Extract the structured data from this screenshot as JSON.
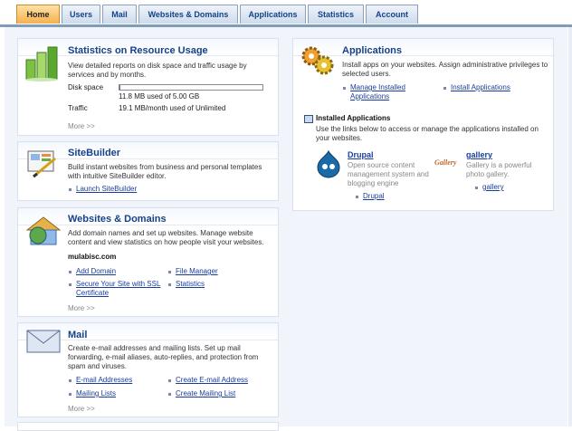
{
  "tabs": [
    "Home",
    "Users",
    "Mail",
    "Websites & Domains",
    "Applications",
    "Statistics",
    "Account"
  ],
  "stats": {
    "title": "Statistics on Resource Usage",
    "desc": "View detailed reports on disk space and traffic usage by services and by months.",
    "disk_label": "Disk space",
    "disk_value": "11.8 MB used of 5.00 GB",
    "disk_used_fraction": 0.0024,
    "traffic_label": "Traffic",
    "traffic_value": "19.1 MB/month used of Unlimited",
    "more": "More >>"
  },
  "sitebuilder": {
    "title": "SiteBuilder",
    "desc": "Build instant websites from business and personal templates with intuitive SiteBuilder editor.",
    "link": "Launch SiteBuilder"
  },
  "websites": {
    "title": "Websites & Domains",
    "desc": "Add domain names and set up websites. Manage website content and view statistics on how people visit your websites.",
    "domain": "mulabisc.com",
    "links": [
      "Add Domain",
      "File Manager",
      "Secure Your Site with SSL Certificate",
      "Statistics"
    ],
    "more": "More >>"
  },
  "mail": {
    "title": "Mail",
    "desc": "Create e-mail addresses and mailing lists. Set up mail forwarding, e-mail aliases, auto-replies, and protection from spam and viruses.",
    "links": [
      "E-mail Addresses",
      "Create E-mail Address",
      "Mailing Lists",
      "Create Mailing List"
    ],
    "more": "More >>"
  },
  "applications": {
    "title": "Applications",
    "desc": "Install apps on your websites. Assign administrative privileges to selected users.",
    "links": [
      "Manage Installed Applications",
      "Install Applications"
    ],
    "installed_title": "Installed Applications",
    "installed_desc": "Use the links below to access or manage the applications installed on your websites.",
    "apps": [
      {
        "name": "Drupal",
        "desc": "Open source content management system and blogging engine",
        "link": "Drupal"
      },
      {
        "name": "gallery",
        "icon_text": "Gallery",
        "desc": "Gallery is a powerful photo gallery.",
        "link": "gallery"
      }
    ]
  },
  "colors": {
    "accent": "#15428b",
    "link": "#1a3d9c",
    "active_tab": "#f6b14d",
    "tab_border": "#7f9db9"
  }
}
